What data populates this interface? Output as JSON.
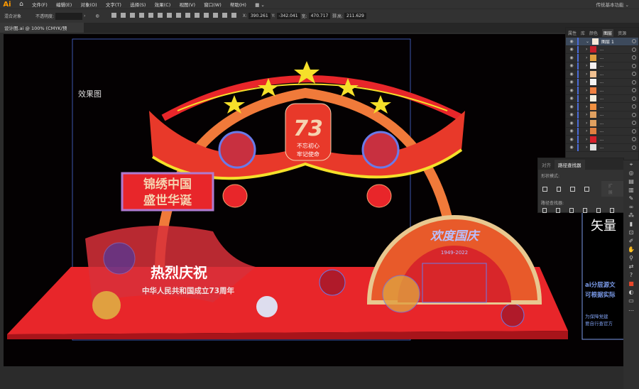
{
  "app": {
    "logo": "Ai",
    "workspace": "传统基本功能"
  },
  "menu": [
    "文件(F)",
    "编辑(E)",
    "对象(O)",
    "文字(T)",
    "选择(S)",
    "效果(C)",
    "视图(V)",
    "窗口(W)",
    "帮助(H)"
  ],
  "control": {
    "selection": "混合对象",
    "opacity_label": "不透明度:",
    "x_label": "X:",
    "x": "390.261",
    "y_label": "Y:",
    "y": "-342.041",
    "w_label": "宽:",
    "w": "470.717",
    "h_label": "高:",
    "h": "211.629"
  },
  "tab": {
    "title": "设计图.ai @ 100% (CMYK/预览)",
    "close": "×"
  },
  "layers_panel": {
    "tabs": [
      "属性",
      "库",
      "颜色",
      "图层",
      "资源"
    ],
    "top_layer": "图层 1",
    "sublayer_label": "..."
  },
  "pathfinder": {
    "tabs": [
      "对齐",
      "路径查找器"
    ],
    "shape_modes": "形状模式:",
    "expand": "扩展",
    "pathfinders": "路径查找器:"
  },
  "artwork": {
    "label": "效果图",
    "scroll_line1": "锦绣中国",
    "scroll_line2": "盛世华诞",
    "badge_number": "73",
    "badge_line1": "不忘初心",
    "badge_line2": "牢记使命",
    "main_title": "热烈庆祝",
    "subtitle": "中华人民共和国成立73周年",
    "fan_title": "欢度国庆",
    "fan_years": "1949-2022",
    "side_title": "矢量",
    "side_line1": "ai分层源文",
    "side_line2": "可根据实际",
    "side_line3": "为保障党建",
    "side_line4": "要自行查官方"
  },
  "colors": {
    "accent": "#ff9a00",
    "red": "#e8262a",
    "yellow": "#f5e02a",
    "selection": "#4a6bd8"
  }
}
